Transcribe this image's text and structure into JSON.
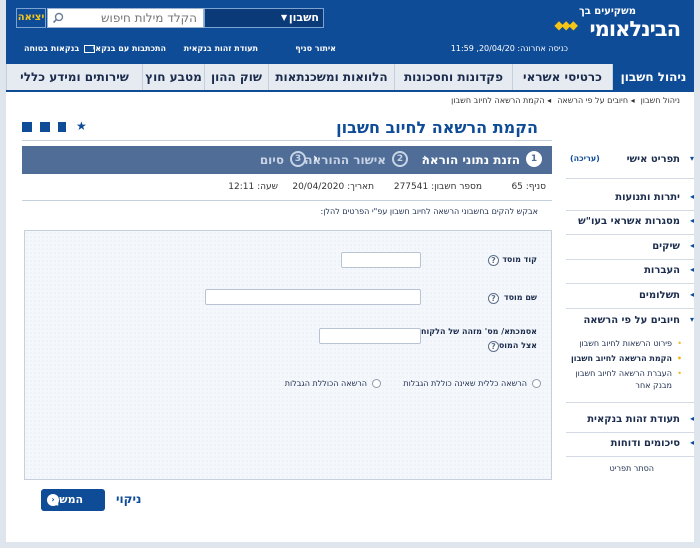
{
  "header": {
    "logo_top": "משקיעים בך",
    "logo_main": "הבינלאומי",
    "exit_label": "יציאה",
    "search_placeholder": "הקלד מילות חיפוש",
    "account_label": "חשבון",
    "last_login": "כניסה אחרונה: 20/04/20,  11:59",
    "links": [
      "איתור סניף",
      "תעודת זהות בנקאית",
      "התכתבות עם בנקאי",
      "בנקאות בטוחה"
    ]
  },
  "nav": {
    "tabs": [
      "ניהול חשבון",
      "כרטיסי אשראי",
      "פקדונות וחסכונות",
      "הלוואות ומשכנתאות",
      "שוק ההון",
      "מטבע חוץ",
      "שירותים ומידע כללי"
    ],
    "active_index": 0
  },
  "breadcrumb": [
    "ניהול חשבון",
    "חיובים על פי הרשאה",
    "הקמת הרשאה לחיוב חשבון"
  ],
  "sidebar": {
    "profile": "תפריט אישי",
    "profile_edit": "(עריכה)",
    "items": [
      "יתרות ותנועות",
      "מסגרות אשראי בעו\"ש",
      "שיקים",
      "העברות",
      "תשלומים",
      "חיובים על פי הרשאה"
    ],
    "sub_items": [
      "פירוט הרשאות לחיוב חשבון",
      "הקמת הרשאה לחיוב חשבון",
      "העברת הרשאה לחיוב חשבון מבנק אחר"
    ],
    "items_bottom": [
      "תעודת זהות בנקאית",
      "סיכומים ודוחות"
    ],
    "hide_menu": "הסתר תפריט"
  },
  "main": {
    "title": "הקמת הרשאה לחיוב חשבון",
    "steps": [
      {
        "num": "1",
        "label": "הזנת נתוני הוראה",
        "state": "active"
      },
      {
        "num": "2",
        "label": "אישור ההוראה",
        "state": "pending"
      },
      {
        "num": "3",
        "label": "סיום",
        "state": "pending"
      }
    ],
    "info": {
      "branch": "סניף:  65",
      "account": "מספר חשבון:  277541",
      "date": "תאריך:  20/04/2020",
      "time": "שעה:  12:11"
    },
    "instruction": "אבקש להקים בחשבוני הרשאה לחיוב חשבון עפ\"י הפרטים להלן:",
    "form": {
      "institution_code_label": "קוד מוסד",
      "institution_name_label": "שם מוסד",
      "reference_label_1": "אסמכתא/ מס' מזהה של הלקוח",
      "reference_label_2": "אצל המוסד",
      "radio_no_limits": "הרשאה כללית שאינה כוללת הגבלות",
      "radio_with_limits": "הרשאה הכוללת הגבלות",
      "help_glyph": "?"
    },
    "continue_button": "המשך",
    "clear_link": "ניקוי"
  },
  "colors": {
    "brand": "#0f4c97",
    "steps_bar": "#4f6d97",
    "accent": "#f3c516"
  }
}
